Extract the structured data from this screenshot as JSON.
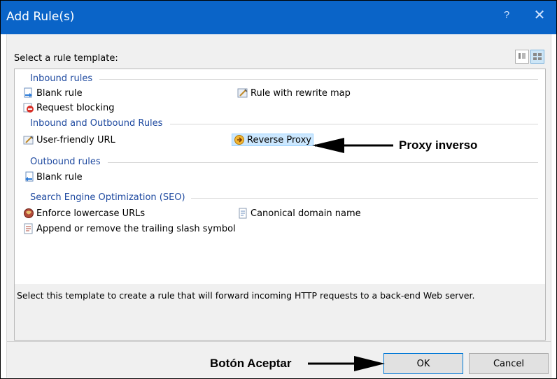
{
  "dialog": {
    "title": "Add Rule(s)",
    "help_label": "?",
    "close_label": "✕",
    "prompt": "Select a rule template:",
    "description": "Select this template to create a rule that will forward incoming HTTP requests to a back-end Web server.",
    "ok_label": "OK",
    "cancel_label": "Cancel"
  },
  "groups": {
    "inbound": {
      "label": "Inbound rules",
      "items": [
        "Blank rule",
        "Rule with rewrite map",
        "Request blocking"
      ]
    },
    "inbound_outbound": {
      "label": "Inbound and Outbound Rules",
      "items": [
        "User-friendly URL",
        "Reverse Proxy"
      ]
    },
    "outbound": {
      "label": "Outbound rules",
      "items": [
        "Blank rule"
      ]
    },
    "seo": {
      "label": "Search Engine Optimization (SEO)",
      "items": [
        "Enforce lowercase URLs",
        "Canonical domain name",
        "Append or remove the trailing slash symbol"
      ]
    }
  },
  "selected_item": "Reverse Proxy",
  "annotations": {
    "proxy": "Proxy inverso",
    "ok_button": "Botón Aceptar"
  },
  "colors": {
    "titlebar": "#0a64c8",
    "group_header": "#1f4aa0",
    "selection": "#cce8ff"
  }
}
